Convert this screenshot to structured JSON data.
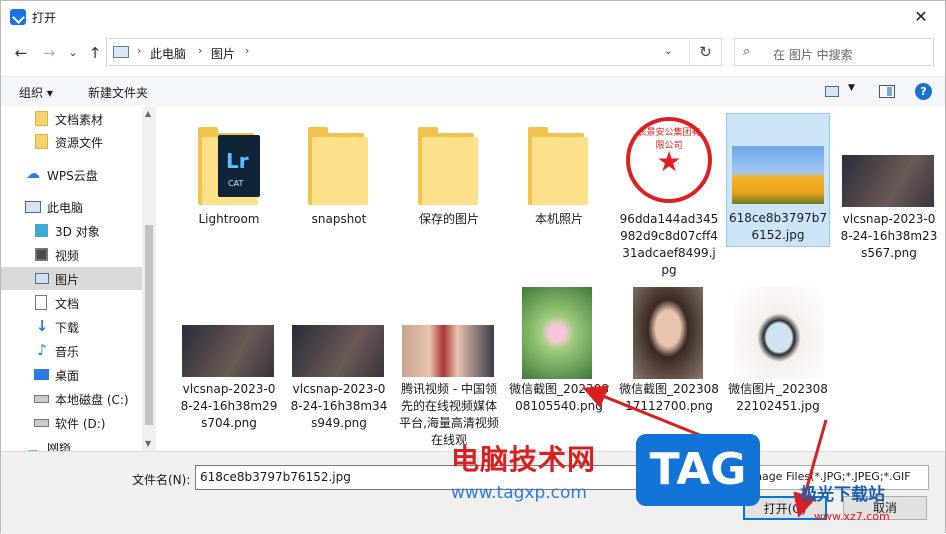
{
  "window": {
    "title": "打开",
    "close_glyph": "✕"
  },
  "nav": {
    "back": "←",
    "forward": "→",
    "recent": "⌄",
    "up": "↑"
  },
  "address": {
    "crumbs": [
      "此电脑",
      "图片"
    ],
    "separator": "›",
    "dropdown": "⌄",
    "refresh": "↻"
  },
  "search": {
    "icon": "⌕",
    "placeholder": "在 图片 中搜索"
  },
  "toolbar": {
    "organize": "组织 ▾",
    "new_folder": "新建文件夹",
    "view_dd": "▼",
    "help": "?"
  },
  "sidebar": {
    "items": [
      {
        "label": "文档素材",
        "icon": "folder-icon"
      },
      {
        "label": "资源文件",
        "icon": "folder-icon"
      },
      {
        "label": "WPS云盘",
        "icon": "cloud-icon"
      },
      {
        "label": "此电脑",
        "icon": "computer-icon"
      },
      {
        "label": "3D 对象",
        "icon": "cube-icon"
      },
      {
        "label": "视频",
        "icon": "video-icon"
      },
      {
        "label": "图片",
        "icon": "pictures-icon"
      },
      {
        "label": "文档",
        "icon": "document-icon"
      },
      {
        "label": "下载",
        "icon": "download-icon"
      },
      {
        "label": "音乐",
        "icon": "music-icon"
      },
      {
        "label": "桌面",
        "icon": "desktop-icon"
      },
      {
        "label": "本地磁盘 (C:)",
        "icon": "drive-icon"
      },
      {
        "label": "软件 (D:)",
        "icon": "drive-icon"
      },
      {
        "label": "网络",
        "icon": "network-icon"
      }
    ],
    "selected": "图片"
  },
  "files": [
    {
      "name": "Lightroom",
      "kind": "folder-lr"
    },
    {
      "name": "snapshot",
      "kind": "folder"
    },
    {
      "name": "保存的图片",
      "kind": "folder"
    },
    {
      "name": "本机照片",
      "kind": "folder"
    },
    {
      "name": "96dda144ad345982d9c8d07cff431adcaef8499.jpg",
      "kind": "stamp"
    },
    {
      "name": "618ce8b3797b76152.jpg",
      "kind": "tulips",
      "selected": true
    },
    {
      "name": "vlcsnap-2023-08-24-16h38m23s567.png",
      "kind": "dark"
    },
    {
      "name": "vlcsnap-2023-08-24-16h38m29s704.png",
      "kind": "dark"
    },
    {
      "name": "vlcsnap-2023-08-24-16h38m34s949.png",
      "kind": "dark"
    },
    {
      "name": "腾讯视频 - 中国领先的在线视频媒体平台,海量高清视频在线观",
      "kind": "group"
    },
    {
      "name": "微信截图_20230808105540.png",
      "kind": "lotus"
    },
    {
      "name": "微信截图_20230817112700.png",
      "kind": "portrait"
    },
    {
      "name": "微信图片_20230822102451.jpg",
      "kind": "sketch"
    }
  ],
  "stamp_text": "长景安公集团有限公司",
  "stamp_star": "★",
  "lr_big": "Lr",
  "lr_small": "CAT",
  "bottom": {
    "filename_label": "文件名(N):",
    "filename_value": "618ce8b3797b76152.jpg",
    "filter_value": "Image Files(*.JPG;*.JPEG;*.GIF",
    "open_button": "打开(O)",
    "cancel_button": "取消"
  },
  "watermark": {
    "site_name": "电脑技术网",
    "url": "www.tagxp.com",
    "badge": "TAG",
    "brand2": "极光下载站",
    "brand2_url": "www.xz7.com"
  },
  "colors": {
    "selection": "#cce4f7",
    "accent": "#0078d7",
    "arrow": "#d82020"
  }
}
